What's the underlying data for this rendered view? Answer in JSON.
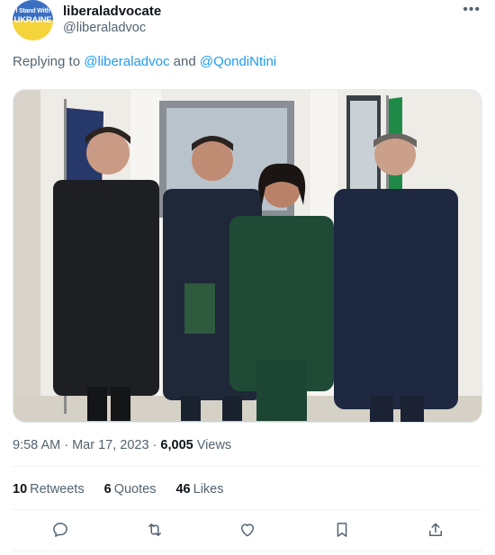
{
  "tweet": {
    "author": {
      "display_name": "liberaladvocate",
      "handle": "@liberaladvoc",
      "avatar_line1": "I Stand With",
      "avatar_line2": "UKRAINE"
    },
    "more_icon": "more-horizontal-icon",
    "replying_prefix": "Replying to",
    "reply_mention_1": "@liberaladvoc",
    "reply_and": "and",
    "reply_mention_2": "@QondiNtini",
    "timestamp": "9:58 AM · Mar 17, 2023 ·",
    "views_count": "6,005",
    "views_label": "Views",
    "retweets_count": "10",
    "retweets_label": "Retweets",
    "quotes_count": "6",
    "quotes_label": "Quotes",
    "likes_count": "46",
    "likes_label": "Likes"
  },
  "actions": [
    "reply-icon",
    "retweet-icon",
    "like-icon",
    "bookmark-icon",
    "share-icon"
  ],
  "colors": {
    "link": "#1d9bf0",
    "secondary_text": "#536471",
    "primary_text": "#0f1419"
  }
}
